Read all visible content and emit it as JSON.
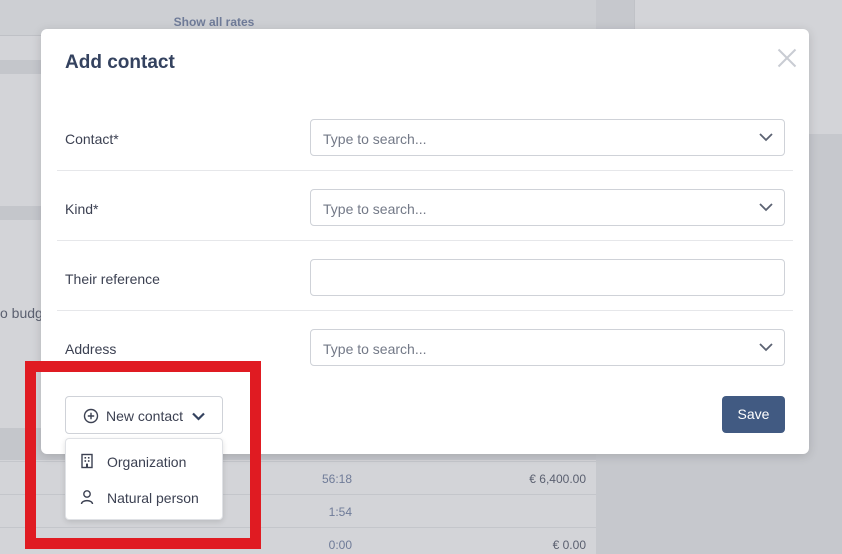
{
  "background": {
    "show_all_rates": "Show all rates",
    "budget_text": "o budge",
    "rows": [
      {
        "time": "56:18",
        "amount": "€ 6,400.00"
      },
      {
        "time": "1:54",
        "amount": ""
      },
      {
        "time": "0:00",
        "amount": "€ 0.00"
      }
    ]
  },
  "modal": {
    "title": "Add contact",
    "close_icon": "close-icon",
    "fields": [
      {
        "label": "Contact*",
        "placeholder": "Type to search...",
        "type": "select"
      },
      {
        "label": "Kind*",
        "placeholder": "Type to search...",
        "type": "select"
      },
      {
        "label": "Their reference",
        "placeholder": "",
        "type": "text"
      },
      {
        "label": "Address",
        "placeholder": "Type to search...",
        "type": "select"
      }
    ],
    "new_contact_label": "New contact",
    "save_label": "Save",
    "dropdown": [
      {
        "label": "Organization",
        "icon": "building-icon"
      },
      {
        "label": "Natural person",
        "icon": "person-icon"
      }
    ]
  },
  "colors": {
    "accent": "#415a82",
    "title": "#34425f",
    "highlight": "#e01b22"
  }
}
